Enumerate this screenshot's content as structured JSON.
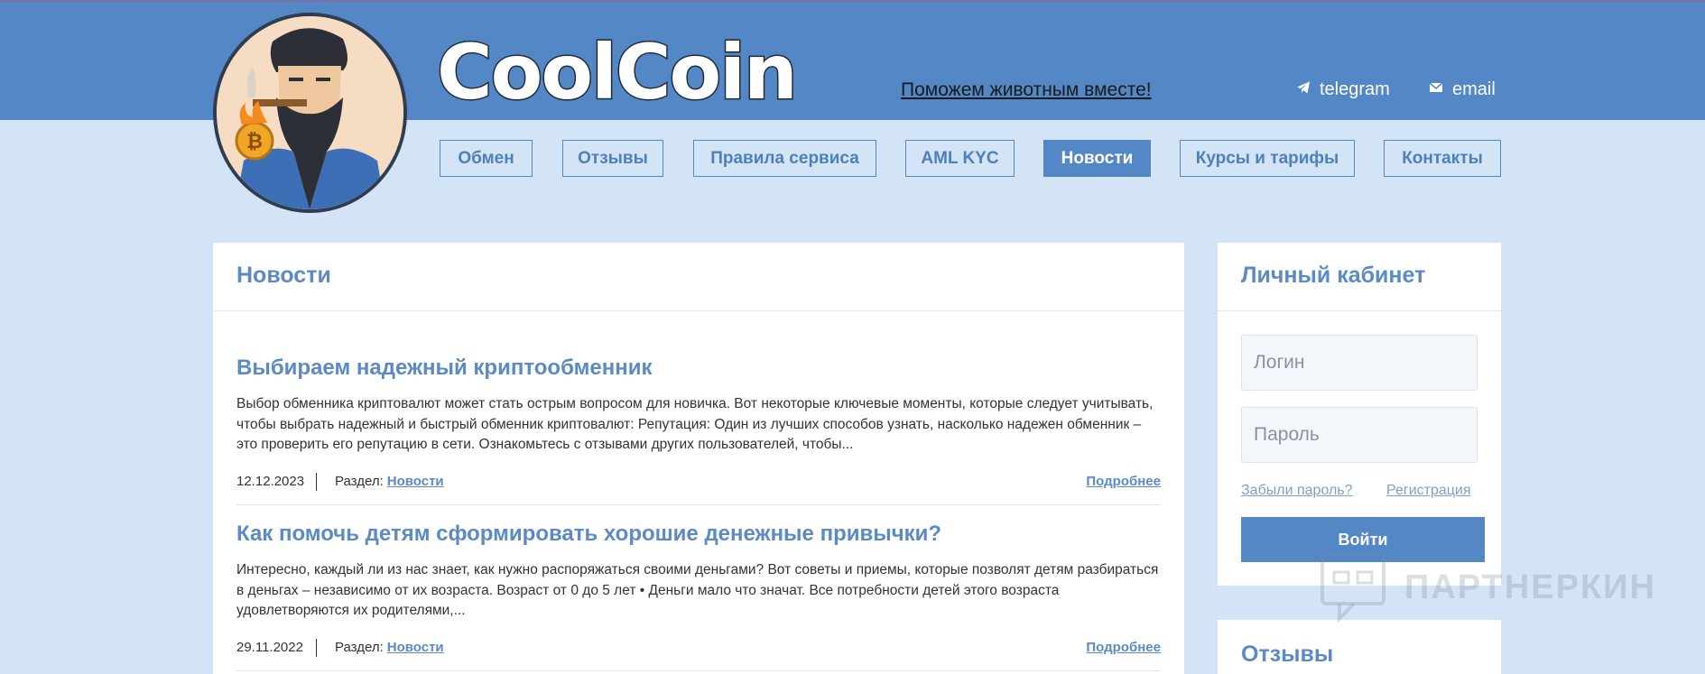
{
  "brand": {
    "logo_text": "CoolCoin"
  },
  "header": {
    "promo_link": "Поможем животным вместе!",
    "telegram_label": "telegram",
    "email_label": "email"
  },
  "nav": {
    "items": [
      {
        "label": "Обмен"
      },
      {
        "label": "Отзывы"
      },
      {
        "label": "Правила сервиса"
      },
      {
        "label": "AML KYC"
      },
      {
        "label": "Новости",
        "active": true
      },
      {
        "label": "Курсы и тарифы"
      },
      {
        "label": "Контакты"
      }
    ]
  },
  "news": {
    "title": "Новости",
    "articles": [
      {
        "title": "Выбираем надежный криптообменник",
        "text": "Выбор обменника криптовалют может стать острым вопросом для новичка. Вот некоторые ключевые моменты, которые следует учитывать, чтобы выбрать надежный и быстрый обменник криптовалют: Репутация: Один из лучших способов узнать, насколько надежен обменник – это проверить его репутацию в сети. Ознакомьтесь с отзывами других пользователей, чтобы...",
        "date": "12.12.2023",
        "section_prefix": "Раздел:",
        "section": "Новости",
        "more": "Подробнее"
      },
      {
        "title": "Как помочь детям сформировать хорошие денежные привычки?",
        "text": "Интересно, каждый ли из нас знает, как нужно распоряжаться своими деньгами? Вот советы и приемы, которые позволят детям разбираться в деньгах – независимо от их возраста. Возраст от 0 до 5 лет • Деньги мало что значат. Все потребности детей этого возраста удовлетворяются их родителями,...",
        "date": "29.11.2022",
        "section_prefix": "Раздел:",
        "section": "Новости",
        "more": "Подробнее"
      }
    ]
  },
  "account": {
    "title": "Личный кабинет",
    "login_placeholder": "Логин",
    "password_placeholder": "Пароль",
    "forgot_link": "Забыли пароль?",
    "register_link": "Регистрация",
    "login_button": "Войти"
  },
  "reviews": {
    "title": "Отзывы"
  },
  "watermark": {
    "text": "ПАРТНЕРКИН"
  },
  "colors": {
    "header_band": "#5487c6",
    "page_bg": "#d4e4f7",
    "accent": "#5c8ac4"
  }
}
